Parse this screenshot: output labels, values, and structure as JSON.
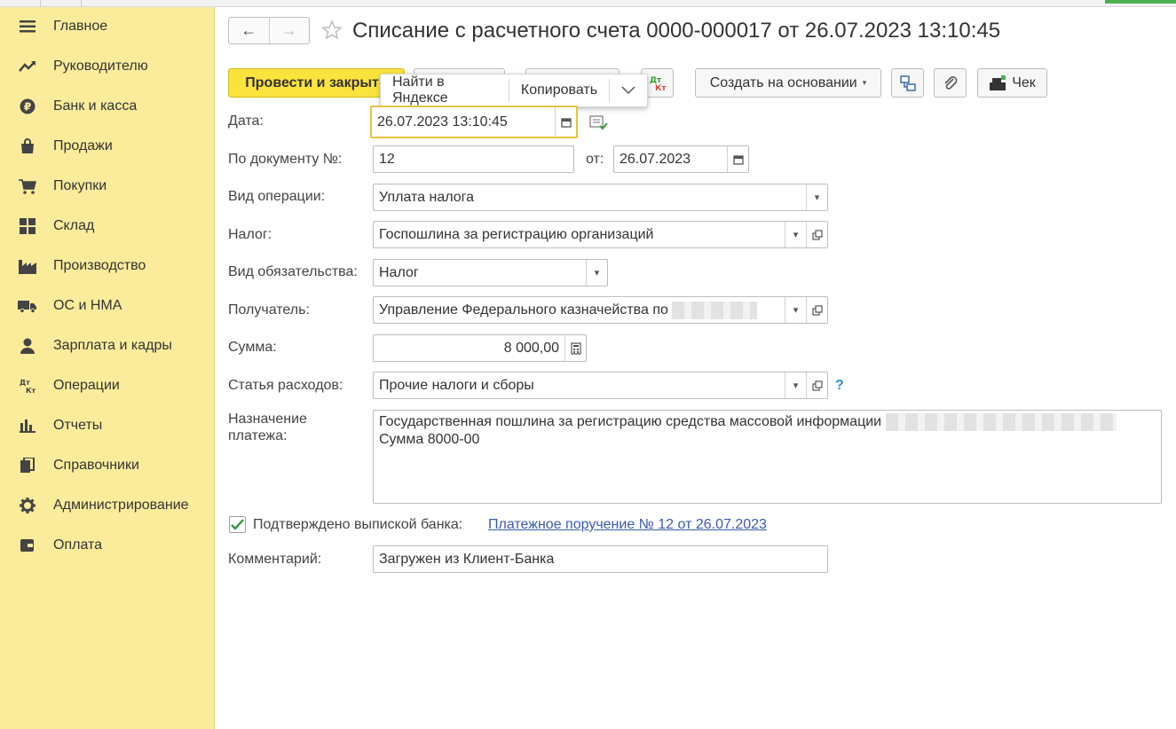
{
  "nav": {
    "back": "←",
    "forward": "→"
  },
  "title": "Списание с расчетного счета 0000-000017 от 26.07.2023 13:10:45",
  "sidebar": [
    {
      "label": "Главное",
      "icon": "menu-icon"
    },
    {
      "label": "Руководителю",
      "icon": "trend-icon"
    },
    {
      "label": "Банк и касса",
      "icon": "ruble-icon"
    },
    {
      "label": "Продажи",
      "icon": "bag-icon"
    },
    {
      "label": "Покупки",
      "icon": "cart-icon"
    },
    {
      "label": "Склад",
      "icon": "warehouse-icon"
    },
    {
      "label": "Производство",
      "icon": "factory-icon"
    },
    {
      "label": "ОС и НМА",
      "icon": "truck-icon"
    },
    {
      "label": "Зарплата и кадры",
      "icon": "person-icon"
    },
    {
      "label": "Операции",
      "icon": "dt-kt-icon"
    },
    {
      "label": "Отчеты",
      "icon": "bar-chart-icon"
    },
    {
      "label": "Справочники",
      "icon": "books-icon"
    },
    {
      "label": "Администрирование",
      "icon": "gear-icon"
    },
    {
      "label": "Оплата",
      "icon": "wallet-icon"
    }
  ],
  "toolbar": {
    "post_close": "Провести и закрыть",
    "dtkt": "Дт Кт",
    "create_based_on": "Создать на основании",
    "check": "Чек"
  },
  "popup": {
    "find_yandex": "Найти в Яндексе",
    "copy": "Копировать"
  },
  "form": {
    "date_label": "Дата:",
    "date_value": "26.07.2023 13:10:45",
    "doc_no_label": "По документу №:",
    "doc_no_value": "12",
    "from_label": "от:",
    "from_value": "26.07.2023",
    "op_type_label": "Вид операции:",
    "op_type_value": "Уплата налога",
    "tax_label": "Налог:",
    "tax_value": "Госпошлина за регистрацию организаций",
    "obligation_label": "Вид обязательства:",
    "obligation_value": "Налог",
    "recipient_label": "Получатель:",
    "recipient_value": "Управление Федерального казначейства по",
    "sum_label": "Сумма:",
    "sum_value": "8 000,00",
    "expense_label": "Статья расходов:",
    "expense_value": "Прочие налоги и сборы",
    "help": "?",
    "purpose_label_1": "Назначение",
    "purpose_label_2": "платежа:",
    "purpose_line_1": "Государственная пошлина за регистрацию средства массовой информации",
    "purpose_line_2": "Сумма 8000-00",
    "confirmed_label": "Подтверждено выпиской банка:",
    "payment_order_link": "Платежное поручение № 12 от 26.07.2023",
    "comment_label": "Комментарий:",
    "comment_value": "Загружен из Клиент-Банка"
  }
}
